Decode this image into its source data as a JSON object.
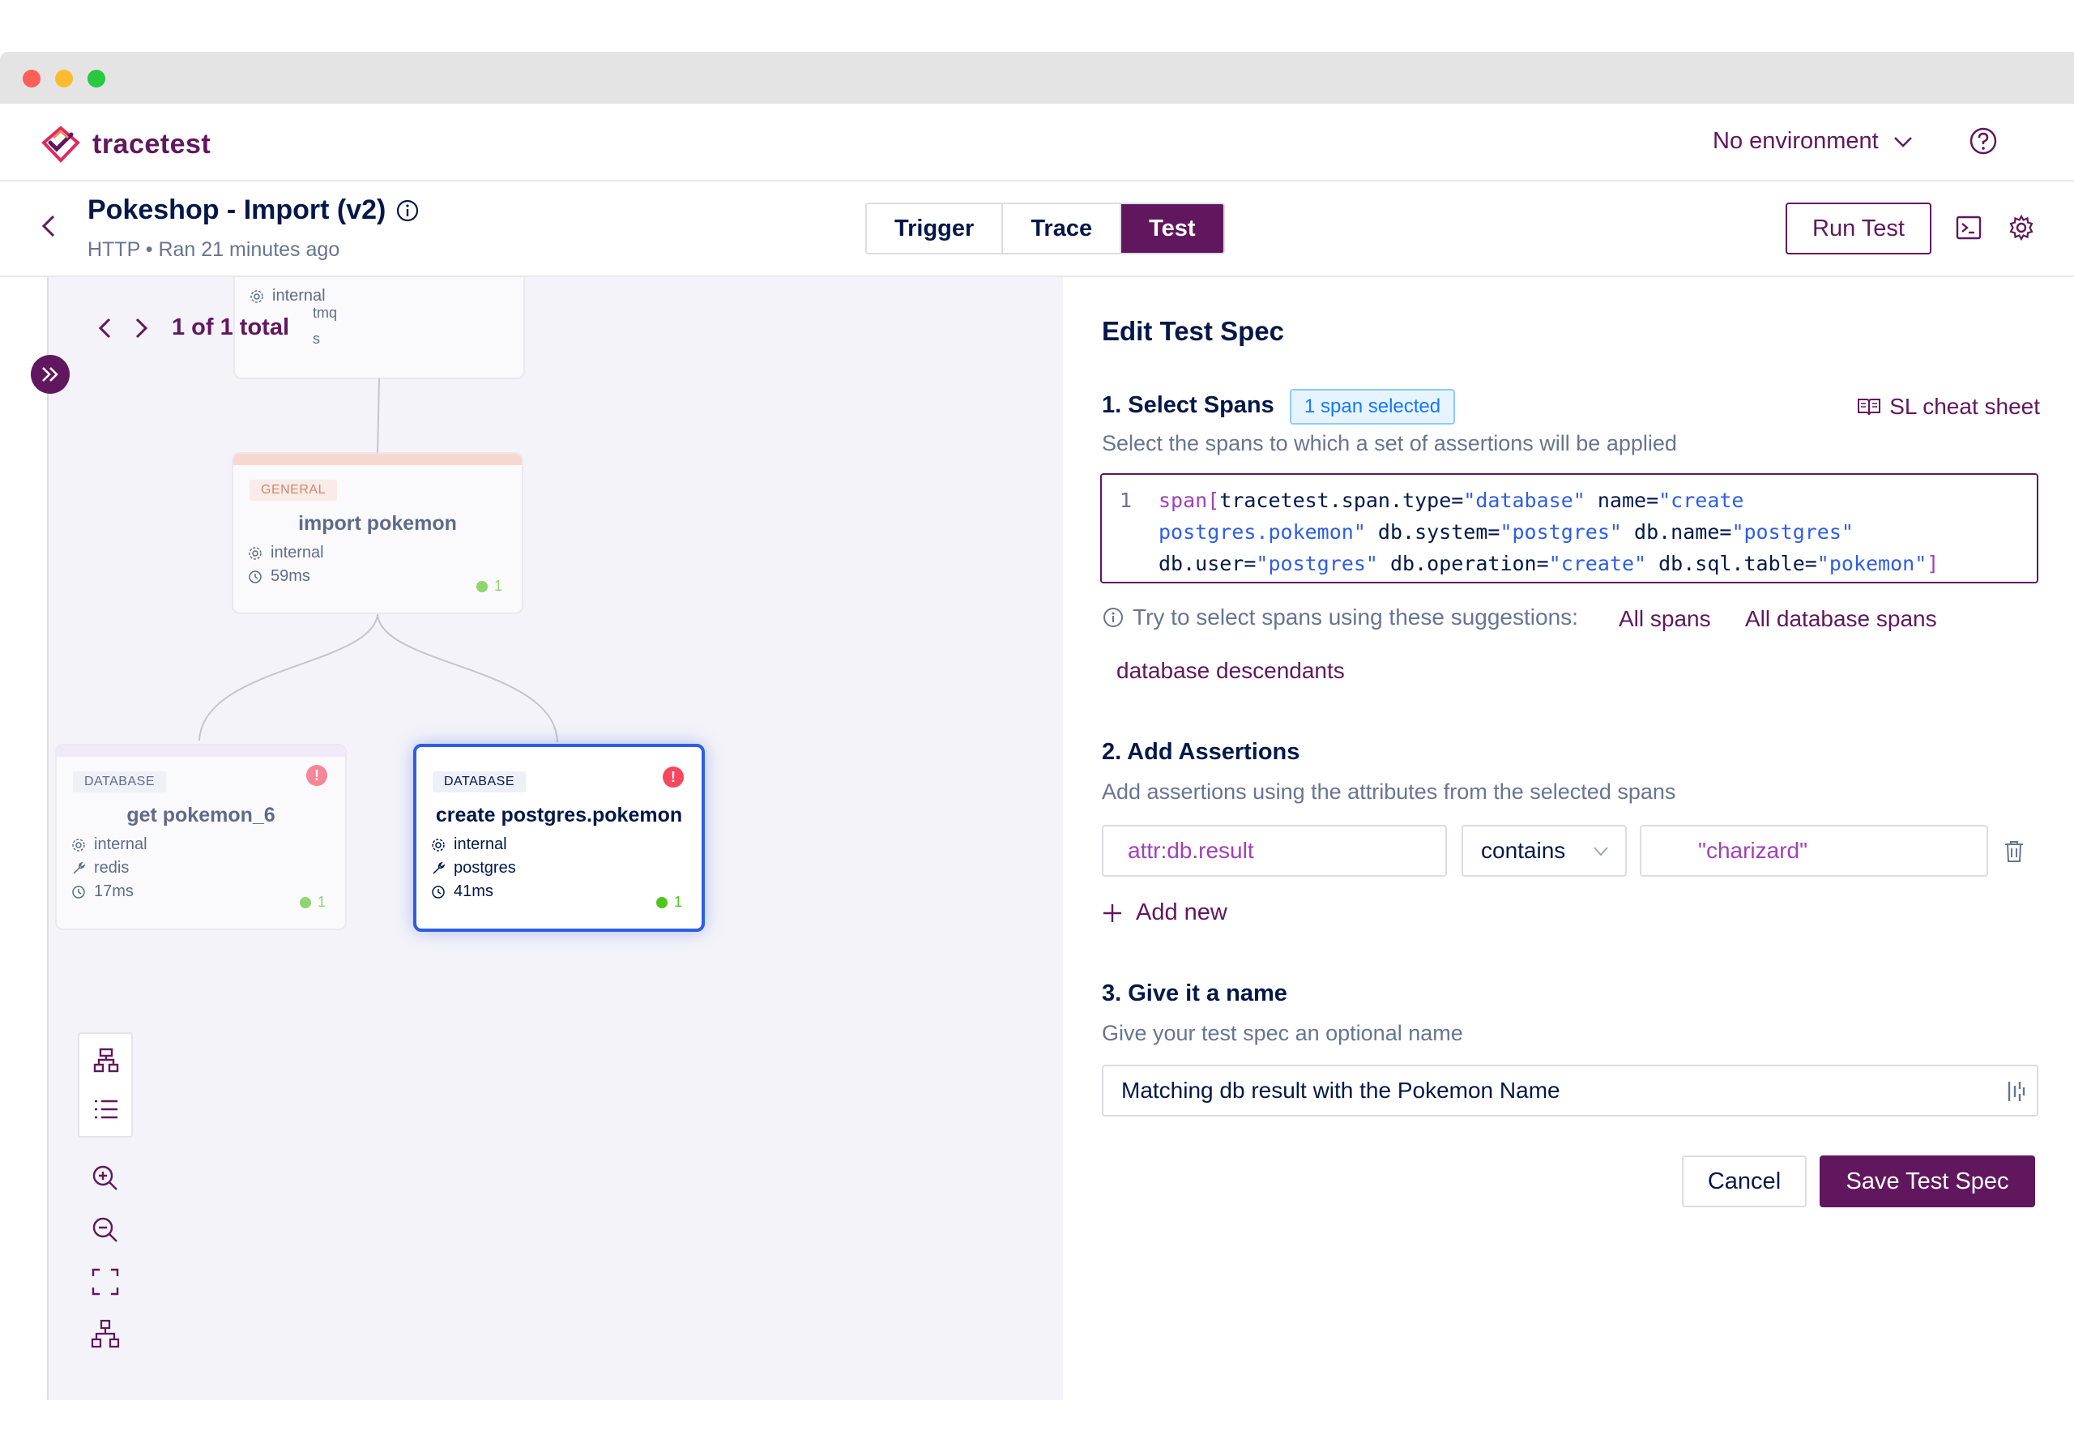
{
  "app": {
    "brand": "tracetest",
    "environment": "No environment"
  },
  "run": {
    "title": "Pokeshop - Import (v2)",
    "meta": "HTTP • Ran 21 minutes ago",
    "tabs": [
      {
        "label": "Trigger",
        "active": false
      },
      {
        "label": "Trace",
        "active": false
      },
      {
        "label": "Test",
        "active": true
      }
    ],
    "run_button": "Run Test"
  },
  "canvas": {
    "pager": "1 of 1 total",
    "nodes": [
      {
        "badge": "",
        "title": "",
        "rows": [
          "internal",
          "tmq",
          "s"
        ]
      },
      {
        "badge": "GENERAL",
        "title": "import pokemon",
        "rows": [
          "internal",
          "59ms"
        ],
        "checks": "1"
      },
      {
        "badge": "DATABASE",
        "title": "get pokemon_6",
        "rows": [
          "internal",
          "redis",
          "17ms"
        ],
        "checks": "1",
        "error": "!"
      },
      {
        "badge": "DATABASE",
        "title": "create postgres.pokemon",
        "rows": [
          "internal",
          "postgres",
          "41ms"
        ],
        "checks": "1",
        "error": "!"
      }
    ]
  },
  "panel": {
    "title": "Edit Test Spec",
    "step1": {
      "title": "1. Select Spans",
      "chip": "1 span selected",
      "cheat_sheet": "SL cheat sheet",
      "subtitle": "Select the spans to which a set of assertions will be applied",
      "line_number": "1",
      "code": {
        "l1a": "span[",
        "l1b": "tracetest.span.type=",
        "l1c": "\"database\"",
        "l1d": " name=",
        "l1e": "\"create",
        "l2a": "postgres.pokemon\"",
        "l2b": " db.system=",
        "l2c": "\"postgres\"",
        "l2d": " db.name=",
        "l2e": "\"postgres\"",
        "l3a": "db.user=",
        "l3b": "\"postgres\"",
        "l3c": " db.operation=",
        "l3d": "\"create\"",
        "l3e": " db.sql.table=",
        "l3f": "\"pokemon\"",
        "l3g": "]"
      },
      "suggest_text": "Try to select spans using these suggestions:",
      "suggestions": [
        "All spans",
        "All database spans",
        "database descendants"
      ]
    },
    "step2": {
      "title": "2. Add Assertions",
      "subtitle": "Add assertions using the attributes from the selected spans",
      "attribute": "attr:db.result",
      "operator": "contains",
      "value": "\"charizard\"",
      "add_new": "Add new"
    },
    "step3": {
      "title": "3. Give it a name",
      "subtitle": "Give your test spec an optional name",
      "name_value": "Matching db result with the Pokemon Name"
    },
    "cancel": "Cancel",
    "save": "Save Test Spec"
  }
}
